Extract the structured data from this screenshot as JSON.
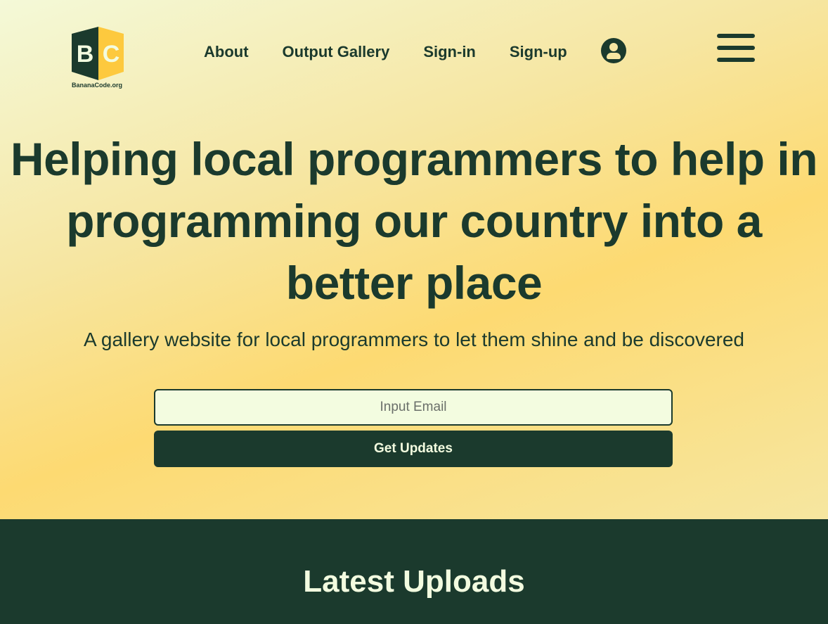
{
  "logo": {
    "letters": "BC",
    "text": "BananaCode.org"
  },
  "nav": {
    "items": [
      "About",
      "Output Gallery",
      "Sign-in",
      "Sign-up"
    ]
  },
  "hero": {
    "title": "Helping local programmers to help in programming our country into a better place",
    "subtitle": "A gallery website for local programmers to let them shine and be discovered",
    "email_placeholder": "Input Email",
    "button": "Get Updates"
  },
  "latest": {
    "title": "Latest Uploads"
  },
  "colors": {
    "primary": "#1b3a2d",
    "accent": "#fdda72",
    "light": "#f3fce0"
  }
}
